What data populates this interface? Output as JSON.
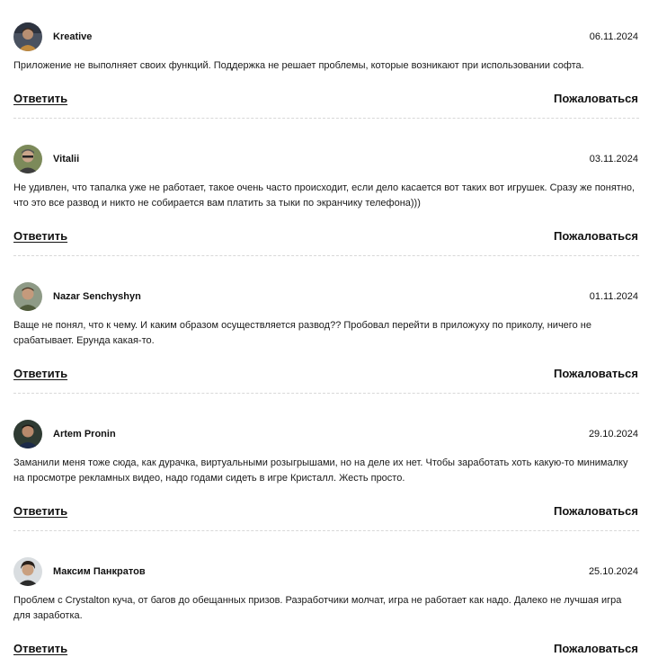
{
  "comments": [
    {
      "author": "Kreative",
      "date": "06.11.2024",
      "text": "Приложение не выполняет своих функций. Поддержка не решает проблемы, которые возникают при использовании софта.",
      "reply_label": "Ответить",
      "report_label": "Пожаловаться",
      "avatar_icon": "user-avatar-photo"
    },
    {
      "author": "Vitalii",
      "date": "03.11.2024",
      "text": "Не удивлен, что тапалка уже не работает, такое очень часто происходит, если дело касается вот таких вот игрушек. Сразу же понятно, что это все развод и никто не собирается вам платить за тыки по экранчику телефона)))",
      "reply_label": "Ответить",
      "report_label": "Пожаловаться",
      "avatar_icon": "user-avatar-photo"
    },
    {
      "author": "Nazar Senchyshyn",
      "date": "01.11.2024",
      "text": "Ваще не понял, что к чему. И каким образом осуществляется развод?? Пробовал перейти в приложуху по приколу, ничего не срабатывает. Ерунда какая-то.",
      "reply_label": "Ответить",
      "report_label": "Пожаловаться",
      "avatar_icon": "user-avatar-photo"
    },
    {
      "author": "Artem Pronin",
      "date": "29.10.2024",
      "text": "Заманили меня тоже сюда, как дурачка, виртуальными розыгрышами, но на деле их нет. Чтобы заработать хоть какую-то минималку на просмотре рекламных видео, надо годами сидеть в игре Кристалл. Жесть просто.",
      "reply_label": "Ответить",
      "report_label": "Пожаловаться",
      "avatar_icon": "user-avatar-photo"
    },
    {
      "author": "Максим Панкратов",
      "date": "25.10.2024",
      "text": "Проблем с Crystalton куча, от багов до обещанных призов. Разработчики молчат, игра не работает как надо. Далеко не лучшая игра для заработка.",
      "reply_label": "Ответить",
      "report_label": "Пожаловаться",
      "avatar_icon": "user-avatar-photo"
    }
  ]
}
